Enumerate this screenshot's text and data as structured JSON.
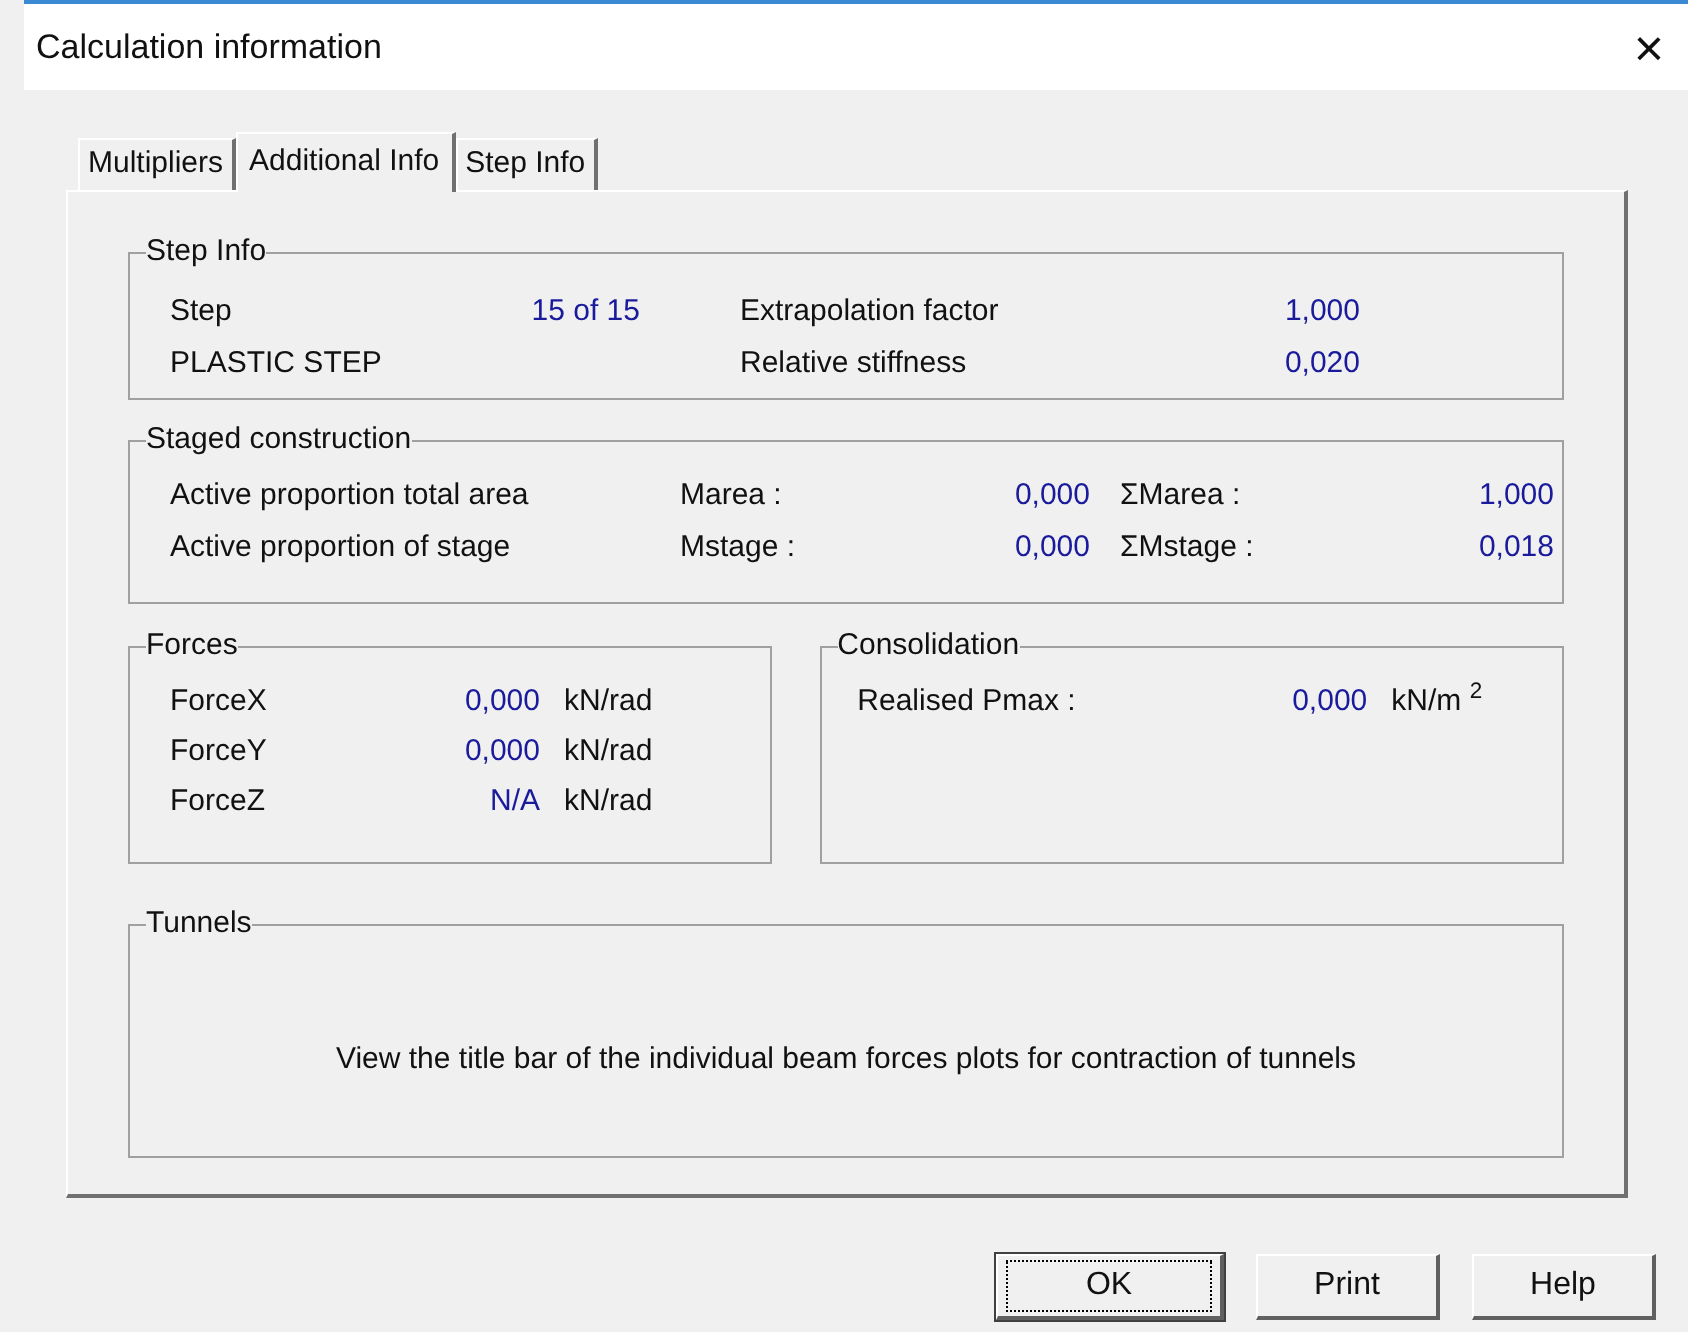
{
  "window": {
    "title": "Calculation information",
    "close": "×"
  },
  "tabs": [
    {
      "label": "Multipliers",
      "selected": false
    },
    {
      "label": "Additional Info",
      "selected": true
    },
    {
      "label": "Step Info",
      "selected": false
    }
  ],
  "step_info": {
    "title": "Step Info",
    "step_label": "Step",
    "step_value": "15 of 15",
    "step_type": "PLASTIC STEP",
    "rows": [
      {
        "label": "Extrapolation factor",
        "value": "1,000"
      },
      {
        "label": "Relative stiffness",
        "value": "0,020"
      }
    ]
  },
  "staged_construction": {
    "title": "Staged construction",
    "rows": [
      {
        "label": "Active proportion total area",
        "symbol": "Marea :",
        "value": "0,000",
        "sum_symbol": "ΣMarea :",
        "sum_value": "1,000"
      },
      {
        "label": "Active proportion of stage",
        "symbol": "Mstage :",
        "value": "0,000",
        "sum_symbol": "ΣMstage :",
        "sum_value": "0,018"
      }
    ]
  },
  "forces": {
    "title": "Forces",
    "rows": [
      {
        "label": "ForceX",
        "value": "0,000",
        "unit": "kN/rad"
      },
      {
        "label": "ForceY",
        "value": "0,000",
        "unit": "kN/rad"
      },
      {
        "label": "ForceZ",
        "value": "N/A",
        "unit": "kN/rad"
      }
    ]
  },
  "consolidation": {
    "title": "Consolidation",
    "label": "Realised Pmax :",
    "value": "0,000",
    "unit": "kN/m $^{2}$"
  },
  "tunnels": {
    "title": "Tunnels",
    "message": "View the title bar of the individual beam forces plots for contraction of tunnels"
  },
  "buttons": [
    {
      "label": "OK",
      "default": true
    },
    {
      "label": "Print",
      "default": false
    },
    {
      "label": "Help",
      "default": false
    }
  ]
}
